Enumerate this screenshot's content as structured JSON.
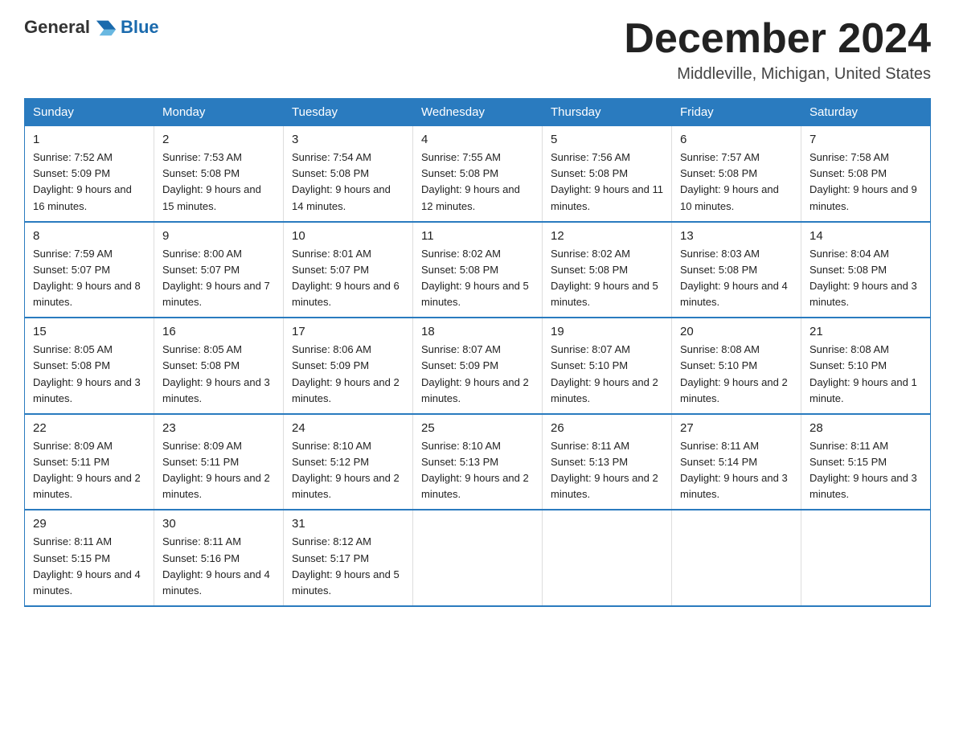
{
  "header": {
    "logo_general": "General",
    "logo_blue": "Blue",
    "month_title": "December 2024",
    "location": "Middleville, Michigan, United States"
  },
  "days_of_week": [
    "Sunday",
    "Monday",
    "Tuesday",
    "Wednesday",
    "Thursday",
    "Friday",
    "Saturday"
  ],
  "weeks": [
    [
      {
        "day": "1",
        "sunrise": "7:52 AM",
        "sunset": "5:09 PM",
        "daylight": "9 hours and 16 minutes."
      },
      {
        "day": "2",
        "sunrise": "7:53 AM",
        "sunset": "5:08 PM",
        "daylight": "9 hours and 15 minutes."
      },
      {
        "day": "3",
        "sunrise": "7:54 AM",
        "sunset": "5:08 PM",
        "daylight": "9 hours and 14 minutes."
      },
      {
        "day": "4",
        "sunrise": "7:55 AM",
        "sunset": "5:08 PM",
        "daylight": "9 hours and 12 minutes."
      },
      {
        "day": "5",
        "sunrise": "7:56 AM",
        "sunset": "5:08 PM",
        "daylight": "9 hours and 11 minutes."
      },
      {
        "day": "6",
        "sunrise": "7:57 AM",
        "sunset": "5:08 PM",
        "daylight": "9 hours and 10 minutes."
      },
      {
        "day": "7",
        "sunrise": "7:58 AM",
        "sunset": "5:08 PM",
        "daylight": "9 hours and 9 minutes."
      }
    ],
    [
      {
        "day": "8",
        "sunrise": "7:59 AM",
        "sunset": "5:07 PM",
        "daylight": "9 hours and 8 minutes."
      },
      {
        "day": "9",
        "sunrise": "8:00 AM",
        "sunset": "5:07 PM",
        "daylight": "9 hours and 7 minutes."
      },
      {
        "day": "10",
        "sunrise": "8:01 AM",
        "sunset": "5:07 PM",
        "daylight": "9 hours and 6 minutes."
      },
      {
        "day": "11",
        "sunrise": "8:02 AM",
        "sunset": "5:08 PM",
        "daylight": "9 hours and 5 minutes."
      },
      {
        "day": "12",
        "sunrise": "8:02 AM",
        "sunset": "5:08 PM",
        "daylight": "9 hours and 5 minutes."
      },
      {
        "day": "13",
        "sunrise": "8:03 AM",
        "sunset": "5:08 PM",
        "daylight": "9 hours and 4 minutes."
      },
      {
        "day": "14",
        "sunrise": "8:04 AM",
        "sunset": "5:08 PM",
        "daylight": "9 hours and 3 minutes."
      }
    ],
    [
      {
        "day": "15",
        "sunrise": "8:05 AM",
        "sunset": "5:08 PM",
        "daylight": "9 hours and 3 minutes."
      },
      {
        "day": "16",
        "sunrise": "8:05 AM",
        "sunset": "5:08 PM",
        "daylight": "9 hours and 3 minutes."
      },
      {
        "day": "17",
        "sunrise": "8:06 AM",
        "sunset": "5:09 PM",
        "daylight": "9 hours and 2 minutes."
      },
      {
        "day": "18",
        "sunrise": "8:07 AM",
        "sunset": "5:09 PM",
        "daylight": "9 hours and 2 minutes."
      },
      {
        "day": "19",
        "sunrise": "8:07 AM",
        "sunset": "5:10 PM",
        "daylight": "9 hours and 2 minutes."
      },
      {
        "day": "20",
        "sunrise": "8:08 AM",
        "sunset": "5:10 PM",
        "daylight": "9 hours and 2 minutes."
      },
      {
        "day": "21",
        "sunrise": "8:08 AM",
        "sunset": "5:10 PM",
        "daylight": "9 hours and 1 minute."
      }
    ],
    [
      {
        "day": "22",
        "sunrise": "8:09 AM",
        "sunset": "5:11 PM",
        "daylight": "9 hours and 2 minutes."
      },
      {
        "day": "23",
        "sunrise": "8:09 AM",
        "sunset": "5:11 PM",
        "daylight": "9 hours and 2 minutes."
      },
      {
        "day": "24",
        "sunrise": "8:10 AM",
        "sunset": "5:12 PM",
        "daylight": "9 hours and 2 minutes."
      },
      {
        "day": "25",
        "sunrise": "8:10 AM",
        "sunset": "5:13 PM",
        "daylight": "9 hours and 2 minutes."
      },
      {
        "day": "26",
        "sunrise": "8:11 AM",
        "sunset": "5:13 PM",
        "daylight": "9 hours and 2 minutes."
      },
      {
        "day": "27",
        "sunrise": "8:11 AM",
        "sunset": "5:14 PM",
        "daylight": "9 hours and 3 minutes."
      },
      {
        "day": "28",
        "sunrise": "8:11 AM",
        "sunset": "5:15 PM",
        "daylight": "9 hours and 3 minutes."
      }
    ],
    [
      {
        "day": "29",
        "sunrise": "8:11 AM",
        "sunset": "5:15 PM",
        "daylight": "9 hours and 4 minutes."
      },
      {
        "day": "30",
        "sunrise": "8:11 AM",
        "sunset": "5:16 PM",
        "daylight": "9 hours and 4 minutes."
      },
      {
        "day": "31",
        "sunrise": "8:12 AM",
        "sunset": "5:17 PM",
        "daylight": "9 hours and 5 minutes."
      },
      null,
      null,
      null,
      null
    ]
  ]
}
